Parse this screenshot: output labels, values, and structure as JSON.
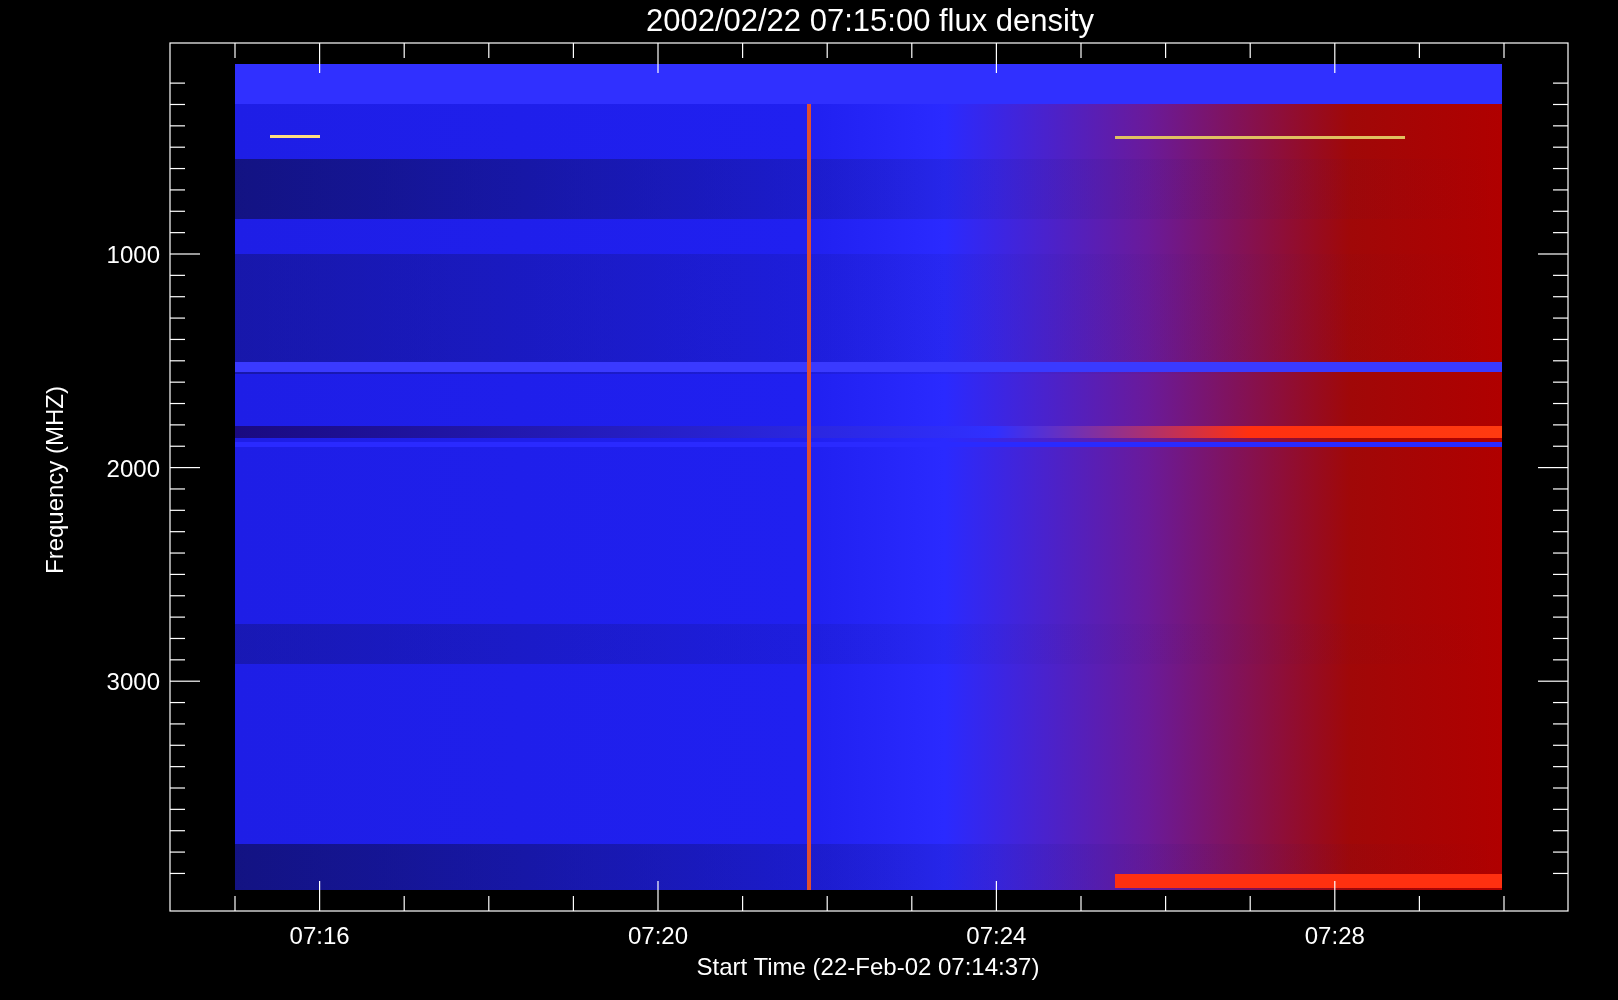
{
  "plot": {
    "title": "2002/02/22 07:15:00 flux density",
    "xlabel": "Start Time (22-Feb-02 07:14:37)",
    "ylabel": "Frequency (MHZ)",
    "yticks": [
      "1000",
      "2000",
      "3000"
    ],
    "xticks": [
      "07:16",
      "07:20",
      "07:24",
      "07:28"
    ]
  }
}
